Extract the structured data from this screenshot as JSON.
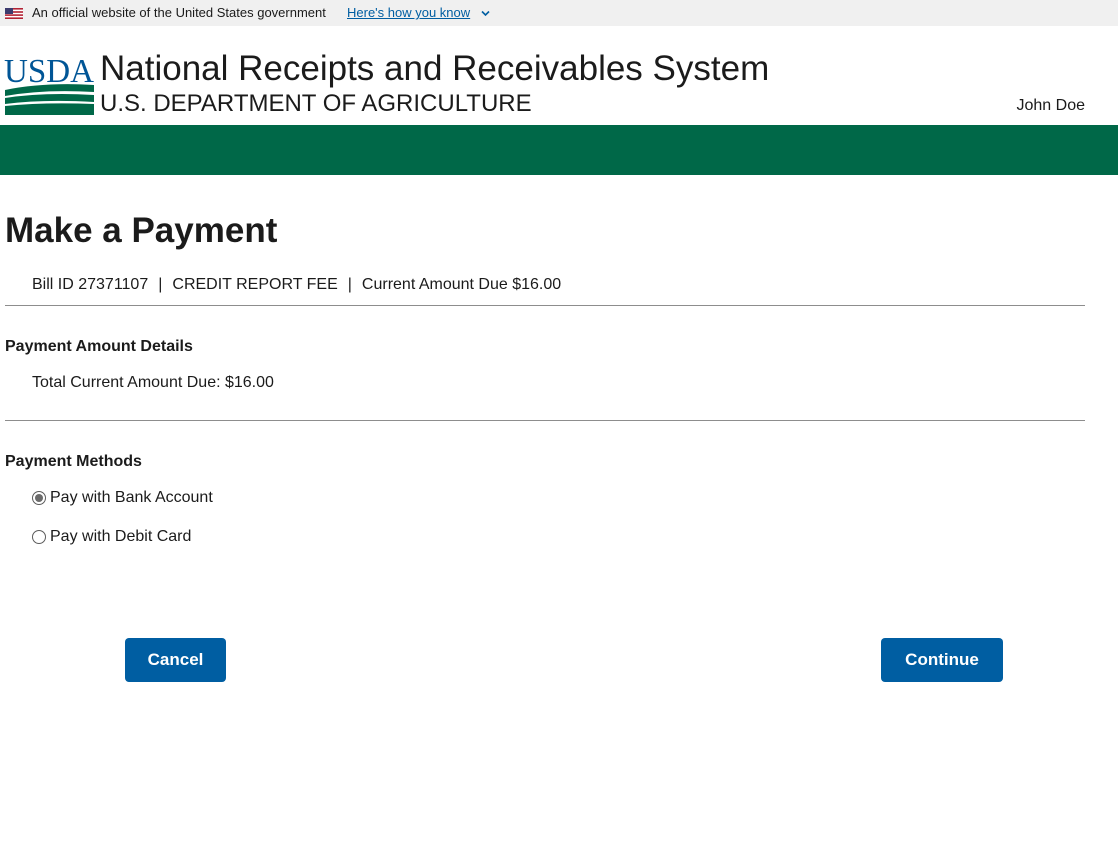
{
  "gov_banner": {
    "official_text": "An official website of the United States government",
    "how_you_know_link": "Here's how you know"
  },
  "header": {
    "logo_text": "USDA",
    "site_title": "National Receipts and Receivables System",
    "site_subtitle": "U.S. DEPARTMENT OF AGRICULTURE",
    "user_name": "John Doe"
  },
  "colors": {
    "brand_green": "#006848",
    "primary_blue": "#005ea2",
    "logo_blue": "#005596",
    "banner_bg": "#f0f0f0"
  },
  "main": {
    "page_title": "Make a Payment",
    "bill": {
      "bill_id": "Bill ID 27371107",
      "fee_type": "CREDIT REPORT FEE",
      "current_amount": "Current Amount Due $16.00",
      "separator": "|"
    },
    "payment_amount": {
      "heading": "Payment Amount Details",
      "total_due": "Total Current Amount Due: $16.00"
    },
    "payment_methods": {
      "heading": "Payment Methods",
      "options": [
        {
          "label": "Pay with Bank Account",
          "selected": true
        },
        {
          "label": "Pay with Debit Card",
          "selected": false
        }
      ]
    },
    "actions": {
      "cancel_label": "Cancel",
      "continue_label": "Continue"
    }
  }
}
